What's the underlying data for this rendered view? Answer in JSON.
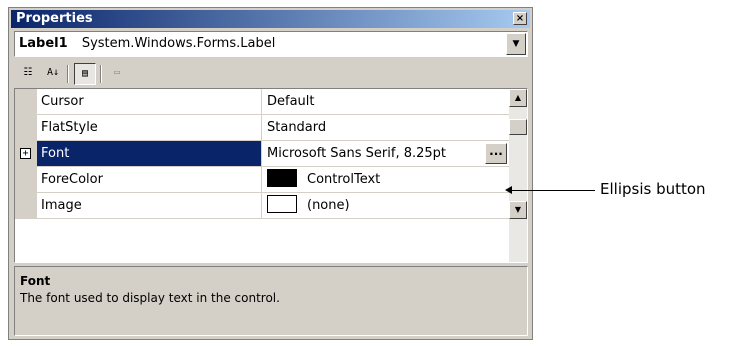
{
  "window": {
    "title": "Properties",
    "close_label": "×"
  },
  "object_selector": {
    "name": "Label1",
    "type": "System.Windows.Forms.Label",
    "dropdown_glyph": "▼"
  },
  "toolbar": {
    "categorized_glyph": "☷",
    "alphabetical_glyph": "A↓",
    "properties_glyph": "▤",
    "property_pages_glyph": "▭"
  },
  "grid": {
    "rows": [
      {
        "name": "Cursor",
        "value": "Default"
      },
      {
        "name": "FlatStyle",
        "value": "Standard"
      },
      {
        "name": "Font",
        "value": "Microsoft Sans Serif, 8.25pt",
        "expander": "+",
        "ellipsis": "...",
        "selected": true
      },
      {
        "name": "ForeColor",
        "value": "ControlText",
        "swatch": "#000000"
      },
      {
        "name": "Image",
        "value": "(none)",
        "swatch": "#ffffff"
      }
    ],
    "scroll_up_glyph": "▲",
    "scroll_down_glyph": "▼"
  },
  "description": {
    "title": "Font",
    "text": "The font used to display text in the control."
  },
  "callout": {
    "label": "Ellipsis button"
  },
  "colors": {
    "selection": "#0a246a",
    "titlebar": "#0a246a",
    "face": "#d4d0c8"
  }
}
